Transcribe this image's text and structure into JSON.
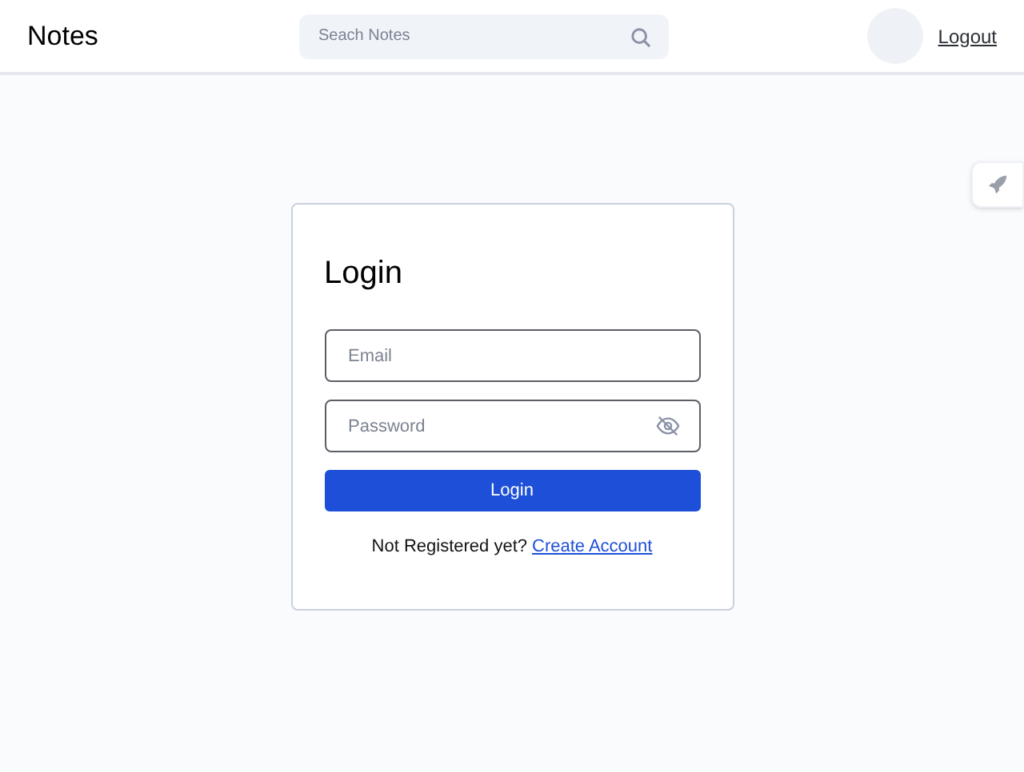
{
  "header": {
    "title": "Notes",
    "search": {
      "placeholder": "Seach Notes"
    },
    "logout": "Logout"
  },
  "login": {
    "title": "Login",
    "email": {
      "placeholder": "Email"
    },
    "password": {
      "placeholder": "Password",
      "visible": false
    },
    "button": "Login",
    "prompt": "Not Registered yet?",
    "link": "Create Account"
  }
}
